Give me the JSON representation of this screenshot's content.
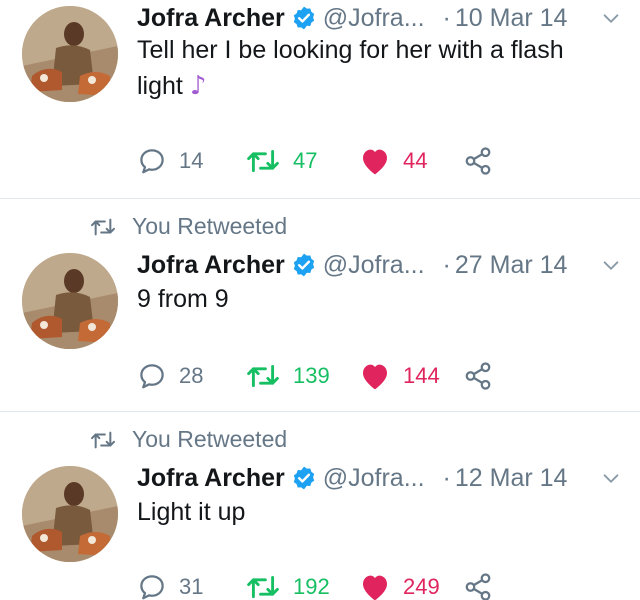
{
  "tweets": [
    {
      "retweet_context": "",
      "author_name": "Jofra Archer",
      "author_handle": "@Jofra...",
      "separator": "·",
      "date": "10 Mar 14",
      "text": "Tell her I be looking for her with a flash light",
      "emoji": "♪",
      "reply_count": "14",
      "retweet_count": "47",
      "like_count": "44"
    },
    {
      "retweet_context": "You Retweeted",
      "author_name": "Jofra Archer",
      "author_handle": "@Jofra...",
      "separator": "·",
      "date": "27 Mar 14",
      "text": "9 from 9",
      "emoji": "",
      "reply_count": "28",
      "retweet_count": "139",
      "like_count": "144"
    },
    {
      "retweet_context": "You Retweeted",
      "author_name": "Jofra Archer",
      "author_handle": "@Jofra...",
      "separator": "·",
      "date": "12 Mar 14",
      "text": "Light it up",
      "emoji": "",
      "reply_count": "31",
      "retweet_count": "192",
      "like_count": "249"
    }
  ],
  "icons": {
    "verified": "verified-badge-icon",
    "caret": "chevron-down-icon",
    "reply": "reply-bubble-icon",
    "retweet": "retweet-arrows-icon",
    "like": "heart-icon",
    "share": "share-nodes-icon",
    "retweet_context": "retweet-arrows-icon"
  },
  "colors": {
    "name": "#14171a",
    "meta": "#657786",
    "verified": "#1da1f2",
    "retweet": "#17bf63",
    "like": "#e0245e",
    "note": "#a05bd0",
    "divider": "#e1e8ed"
  }
}
